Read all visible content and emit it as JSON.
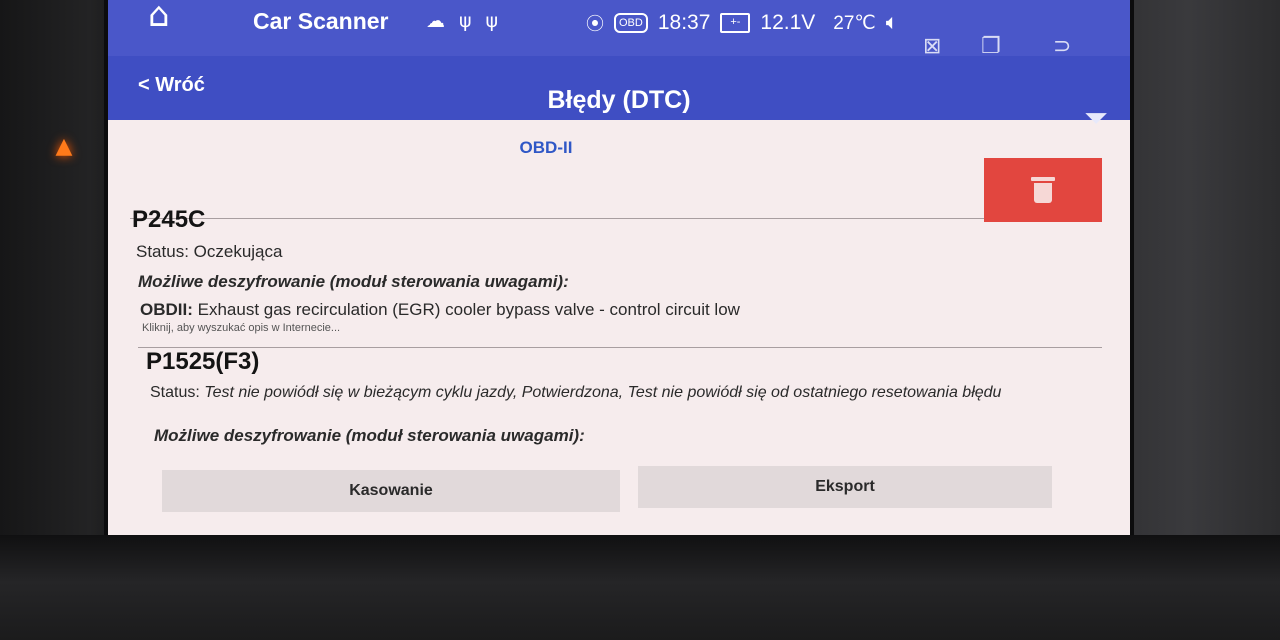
{
  "statusbar": {
    "app_name": "Car Scanner",
    "time": "18:37",
    "voltage": "12.1V",
    "temperature": "27℃",
    "chip_label": "OBD",
    "battery_glyph": "+-",
    "icons": [
      "home-icon",
      "cloud-icon",
      "usb-icon",
      "usb-icon",
      "location-icon",
      "chip-icon",
      "battery-icon",
      "volume-icon",
      "close-window-icon",
      "recent-apps-icon",
      "back-icon"
    ]
  },
  "appbar": {
    "back_label": "< Wróć",
    "title": "Błędy (DTC)",
    "filter_icon": "filter-icon"
  },
  "content": {
    "section_header": "OBD-II",
    "delete_icon": "trash-icon",
    "dtcs": [
      {
        "code": "P245C",
        "status": "Status: Oczekująca",
        "decode_label": "Możliwe deszyfrowanie (moduł sterowania uwagami):",
        "decode_prefix": "OBDII:",
        "decode_text": " Exhaust gas recirculation (EGR) cooler bypass valve - control circuit low",
        "hint": "Kliknij, aby wyszukać opis w Internecie..."
      },
      {
        "code": "P1525(F3)",
        "status_prefix": "Status:",
        "status_text": " Test nie powiódł się w bieżącym cyklu jazdy, Potwierdzona, Test nie powiódł się od ostatniego resetowania błędu",
        "decode_label": "Możliwe deszyfrowanie (moduł sterowania uwagami):"
      }
    ]
  },
  "actions": {
    "clear_label": "Kasowanie",
    "export_label": "Eksport"
  },
  "colors": {
    "statusbar": "#4a57c9",
    "appbar": "#3f4ec3",
    "delete": "#e2463f",
    "section_header": "#2f57c6",
    "background": "#f6eced"
  }
}
